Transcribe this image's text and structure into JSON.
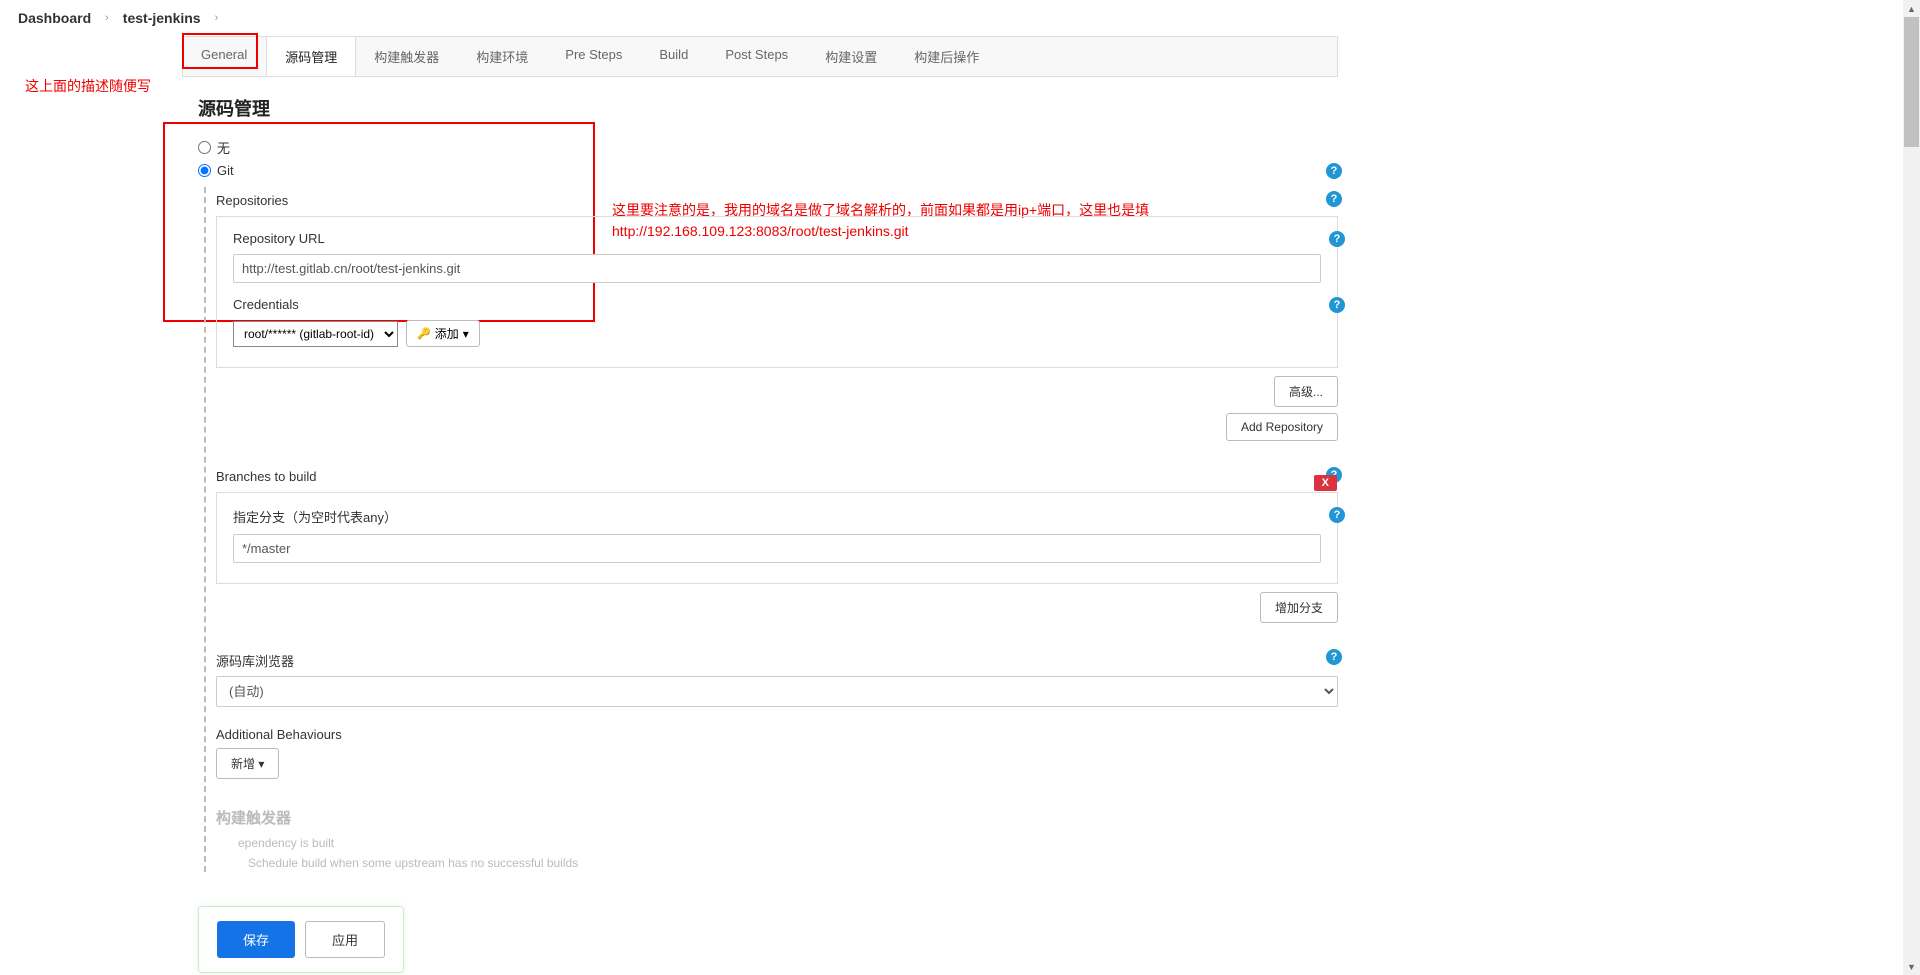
{
  "breadcrumb": {
    "dashboard": "Dashboard",
    "project": "test-jenkins"
  },
  "tabs": [
    "General",
    "源码管理",
    "构建触发器",
    "构建环境",
    "Pre Steps",
    "Build",
    "Post Steps",
    "构建设置",
    "构建后操作"
  ],
  "activeTab": 1,
  "annotations": {
    "top": "这上面的描述随便写",
    "repo_line1": "这里要注意的是，我用的域名是做了域名解析的，前面如果都是用ip+端口，这里也是填",
    "repo_line2": "http://192.168.109.123:8083/root/test-jenkins.git"
  },
  "scm": {
    "title": "源码管理",
    "none": "无",
    "git": "Git",
    "repositories": "Repositories",
    "repoUrlLabel": "Repository URL",
    "repoUrlValue": "http://test.gitlab.cn/root/test-jenkins.git",
    "credentialsLabel": "Credentials",
    "credentialsValue": "root/****** (gitlab-root-id)",
    "addLabel": "添加",
    "advanced": "高级...",
    "addRepo": "Add Repository",
    "branchesTitle": "Branches to build",
    "branchSpecLabel": "指定分支（为空时代表any）",
    "branchValue": "*/master",
    "addBranch": "增加分支",
    "browserLabel": "源码库浏览器",
    "browserValue": "(自动)",
    "additionalLabel": "Additional Behaviours",
    "newBtn": "新增",
    "deleteX": "X"
  },
  "triggers": {
    "title": "构建触发器",
    "item1": "ependency is built",
    "item2": "Schedule build when some upstream has no successful builds"
  },
  "actions": {
    "save": "保存",
    "apply": "应用"
  },
  "help": "?"
}
